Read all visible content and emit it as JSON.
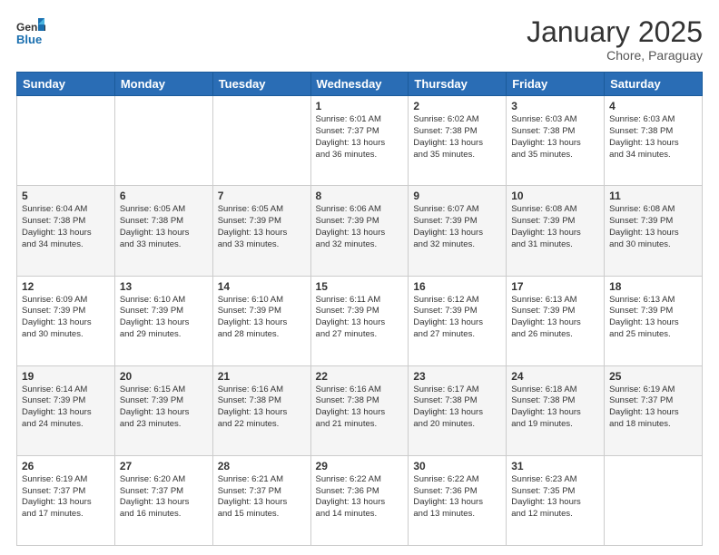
{
  "header": {
    "logo_general": "General",
    "logo_blue": "Blue",
    "month_title": "January 2025",
    "location": "Chore, Paraguay"
  },
  "weekdays": [
    "Sunday",
    "Monday",
    "Tuesday",
    "Wednesday",
    "Thursday",
    "Friday",
    "Saturday"
  ],
  "weeks": [
    [
      {
        "day": "",
        "info": ""
      },
      {
        "day": "",
        "info": ""
      },
      {
        "day": "",
        "info": ""
      },
      {
        "day": "1",
        "info": "Sunrise: 6:01 AM\nSunset: 7:37 PM\nDaylight: 13 hours\nand 36 minutes."
      },
      {
        "day": "2",
        "info": "Sunrise: 6:02 AM\nSunset: 7:38 PM\nDaylight: 13 hours\nand 35 minutes."
      },
      {
        "day": "3",
        "info": "Sunrise: 6:03 AM\nSunset: 7:38 PM\nDaylight: 13 hours\nand 35 minutes."
      },
      {
        "day": "4",
        "info": "Sunrise: 6:03 AM\nSunset: 7:38 PM\nDaylight: 13 hours\nand 34 minutes."
      }
    ],
    [
      {
        "day": "5",
        "info": "Sunrise: 6:04 AM\nSunset: 7:38 PM\nDaylight: 13 hours\nand 34 minutes."
      },
      {
        "day": "6",
        "info": "Sunrise: 6:05 AM\nSunset: 7:38 PM\nDaylight: 13 hours\nand 33 minutes."
      },
      {
        "day": "7",
        "info": "Sunrise: 6:05 AM\nSunset: 7:39 PM\nDaylight: 13 hours\nand 33 minutes."
      },
      {
        "day": "8",
        "info": "Sunrise: 6:06 AM\nSunset: 7:39 PM\nDaylight: 13 hours\nand 32 minutes."
      },
      {
        "day": "9",
        "info": "Sunrise: 6:07 AM\nSunset: 7:39 PM\nDaylight: 13 hours\nand 32 minutes."
      },
      {
        "day": "10",
        "info": "Sunrise: 6:08 AM\nSunset: 7:39 PM\nDaylight: 13 hours\nand 31 minutes."
      },
      {
        "day": "11",
        "info": "Sunrise: 6:08 AM\nSunset: 7:39 PM\nDaylight: 13 hours\nand 30 minutes."
      }
    ],
    [
      {
        "day": "12",
        "info": "Sunrise: 6:09 AM\nSunset: 7:39 PM\nDaylight: 13 hours\nand 30 minutes."
      },
      {
        "day": "13",
        "info": "Sunrise: 6:10 AM\nSunset: 7:39 PM\nDaylight: 13 hours\nand 29 minutes."
      },
      {
        "day": "14",
        "info": "Sunrise: 6:10 AM\nSunset: 7:39 PM\nDaylight: 13 hours\nand 28 minutes."
      },
      {
        "day": "15",
        "info": "Sunrise: 6:11 AM\nSunset: 7:39 PM\nDaylight: 13 hours\nand 27 minutes."
      },
      {
        "day": "16",
        "info": "Sunrise: 6:12 AM\nSunset: 7:39 PM\nDaylight: 13 hours\nand 27 minutes."
      },
      {
        "day": "17",
        "info": "Sunrise: 6:13 AM\nSunset: 7:39 PM\nDaylight: 13 hours\nand 26 minutes."
      },
      {
        "day": "18",
        "info": "Sunrise: 6:13 AM\nSunset: 7:39 PM\nDaylight: 13 hours\nand 25 minutes."
      }
    ],
    [
      {
        "day": "19",
        "info": "Sunrise: 6:14 AM\nSunset: 7:39 PM\nDaylight: 13 hours\nand 24 minutes."
      },
      {
        "day": "20",
        "info": "Sunrise: 6:15 AM\nSunset: 7:39 PM\nDaylight: 13 hours\nand 23 minutes."
      },
      {
        "day": "21",
        "info": "Sunrise: 6:16 AM\nSunset: 7:38 PM\nDaylight: 13 hours\nand 22 minutes."
      },
      {
        "day": "22",
        "info": "Sunrise: 6:16 AM\nSunset: 7:38 PM\nDaylight: 13 hours\nand 21 minutes."
      },
      {
        "day": "23",
        "info": "Sunrise: 6:17 AM\nSunset: 7:38 PM\nDaylight: 13 hours\nand 20 minutes."
      },
      {
        "day": "24",
        "info": "Sunrise: 6:18 AM\nSunset: 7:38 PM\nDaylight: 13 hours\nand 19 minutes."
      },
      {
        "day": "25",
        "info": "Sunrise: 6:19 AM\nSunset: 7:37 PM\nDaylight: 13 hours\nand 18 minutes."
      }
    ],
    [
      {
        "day": "26",
        "info": "Sunrise: 6:19 AM\nSunset: 7:37 PM\nDaylight: 13 hours\nand 17 minutes."
      },
      {
        "day": "27",
        "info": "Sunrise: 6:20 AM\nSunset: 7:37 PM\nDaylight: 13 hours\nand 16 minutes."
      },
      {
        "day": "28",
        "info": "Sunrise: 6:21 AM\nSunset: 7:37 PM\nDaylight: 13 hours\nand 15 minutes."
      },
      {
        "day": "29",
        "info": "Sunrise: 6:22 AM\nSunset: 7:36 PM\nDaylight: 13 hours\nand 14 minutes."
      },
      {
        "day": "30",
        "info": "Sunrise: 6:22 AM\nSunset: 7:36 PM\nDaylight: 13 hours\nand 13 minutes."
      },
      {
        "day": "31",
        "info": "Sunrise: 6:23 AM\nSunset: 7:35 PM\nDaylight: 13 hours\nand 12 minutes."
      },
      {
        "day": "",
        "info": ""
      }
    ]
  ]
}
